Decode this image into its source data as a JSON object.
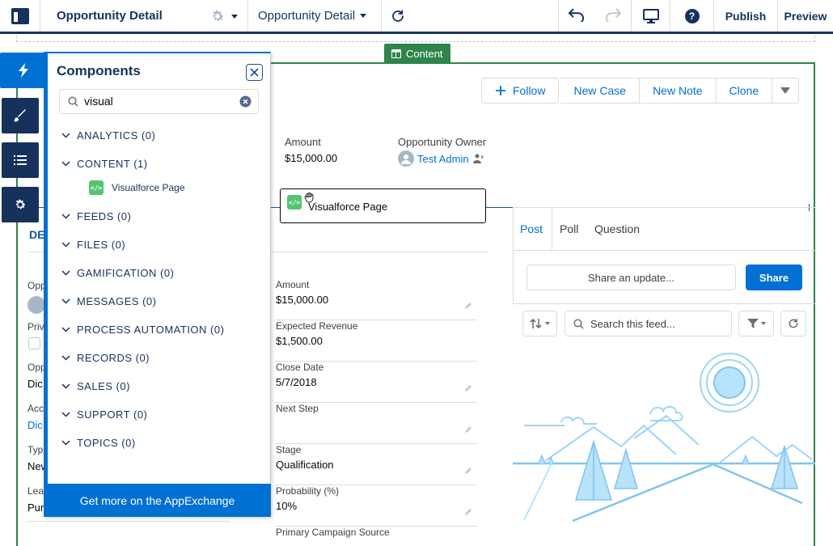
{
  "toolbar": {
    "page_title": "Opportunity Detail",
    "page_selector": "Opportunity Detail",
    "publish_label": "Publish",
    "preview_label": "Preview",
    "help_glyph": "?"
  },
  "canvas": {
    "content_tag": "Content",
    "actions": {
      "follow": "Follow",
      "new_case": "New Case",
      "new_note": "New Note",
      "clone": "Clone"
    },
    "highlights": {
      "amount_label": "Amount",
      "amount_value": "$15,000.00",
      "owner_label": "Opportunity Owner",
      "owner_value": "Test Admin"
    },
    "drag_preview": {
      "icon": "</>",
      "label": "Visualforce Page"
    },
    "detail_tab": "DE",
    "partial_left": {
      "opp": "Opp",
      "priv": "Priv",
      "opp2": "Opp",
      "dic": "Dic",
      "acc": "Acc",
      "dic2": "Dic",
      "typ": "Typ",
      "nev": "New",
      "lea": "Lea",
      "pur": "Pur"
    },
    "fields": [
      {
        "label": "Amount",
        "value": "$15,000.00"
      },
      {
        "label": "Expected Revenue",
        "value": "$1,500.00"
      },
      {
        "label": "Close Date",
        "value": "5/7/2018"
      },
      {
        "label": "Next Step",
        "value": ""
      },
      {
        "label": "Stage",
        "value": "Qualification"
      },
      {
        "label": "Probability (%)",
        "value": "10%"
      },
      {
        "label": "Primary Campaign Source",
        "value": ""
      }
    ]
  },
  "feed": {
    "tabs": [
      "Post",
      "Poll",
      "Question"
    ],
    "share_placeholder": "Share an update...",
    "share_button": "Share",
    "search_placeholder": "Search this feed..."
  },
  "panel": {
    "title": "Components",
    "search_value": "visual",
    "categories": [
      "ANALYTICS (0)",
      "CONTENT (1)",
      "FEEDS (0)",
      "FILES (0)",
      "GAMIFICATION (0)",
      "MESSAGES (0)",
      "PROCESS AUTOMATION (0)",
      "RECORDS (0)",
      "SALES (0)",
      "SUPPORT (0)",
      "TOPICS (0)"
    ],
    "content_item": {
      "icon": "</>",
      "label": "Visualforce Page"
    },
    "appexchange": "Get more on the AppExchange"
  },
  "colors": {
    "navy": "#16325c",
    "brand_blue": "#0070d2",
    "green": "#2e844a",
    "vf_green": "#54c473"
  }
}
